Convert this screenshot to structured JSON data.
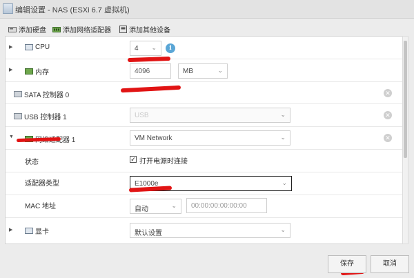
{
  "window": {
    "title": "编辑设置 - NAS (ESXi 6.7 虚拟机)"
  },
  "toolbar": {
    "add_disk": "添加硬盘",
    "add_network_adapter": "添加网络适配器",
    "add_other_device": "添加其他设备"
  },
  "rows": {
    "cpu": {
      "label": "CPU",
      "value": "4"
    },
    "memory": {
      "label": "内存",
      "value": "4096",
      "unit": "MB"
    },
    "sata": {
      "label": "SATA 控制器 0"
    },
    "usb": {
      "label": "USB 控制器 1",
      "value": "USB"
    },
    "network": {
      "label": "网络适配器 1",
      "value": "VM Network",
      "status_label": "状态",
      "connect_on_power_on": "打开电源时连接",
      "connect_checked": true,
      "adapter_type_label": "适配器类型",
      "adapter_type_value": "E1000e",
      "mac_label": "MAC 地址",
      "mac_mode": "自动",
      "mac_value": "00:00:00:00:00:00"
    },
    "video": {
      "label": "显卡",
      "value": "默认设置"
    }
  },
  "footer": {
    "save": "保存",
    "cancel": "取消"
  },
  "colors": {
    "annotation": "#e11414",
    "info": "#5aa6d6"
  }
}
